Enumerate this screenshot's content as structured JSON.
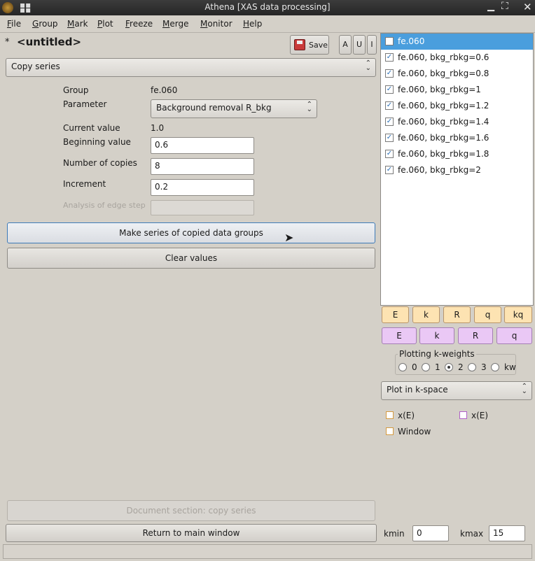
{
  "window": {
    "title": "Athena [XAS data processing]"
  },
  "menu": [
    "File",
    "Group",
    "Mark",
    "Plot",
    "Freeze",
    "Merge",
    "Monitor",
    "Help"
  ],
  "project": {
    "modified_marker": "*",
    "name": "<untitled>"
  },
  "toolbar": {
    "save_label": "Save",
    "a_label": "A",
    "u_label": "U",
    "i_label": "I"
  },
  "panel_select": "Copy series",
  "form": {
    "group_label": "Group",
    "group_value": "fe.060",
    "parameter_label": "Parameter",
    "parameter_value": "Background removal R_bkg",
    "current_label": "Current value",
    "current_value": "1.0",
    "beginning_label": "Beginning value",
    "beginning_value": "0.6",
    "copies_label": "Number of copies",
    "copies_value": "8",
    "increment_label": "Increment",
    "increment_value": "0.2",
    "edge_label": "Analysis of edge step",
    "edge_value": ""
  },
  "buttons": {
    "make_series": "Make series of copied data groups",
    "clear": "Clear values",
    "document": "Document section: copy series",
    "return": "Return to main window"
  },
  "groups": [
    {
      "label": "fe.060",
      "checked": false,
      "selected": true
    },
    {
      "label": "fe.060, bkg_rbkg=0.6",
      "checked": true
    },
    {
      "label": "fe.060, bkg_rbkg=0.8",
      "checked": true
    },
    {
      "label": "fe.060, bkg_rbkg=1",
      "checked": true
    },
    {
      "label": "fe.060, bkg_rbkg=1.2",
      "checked": true
    },
    {
      "label": "fe.060, bkg_rbkg=1.4",
      "checked": true
    },
    {
      "label": "fe.060, bkg_rbkg=1.6",
      "checked": true
    },
    {
      "label": "fe.060, bkg_rbkg=1.8",
      "checked": true
    },
    {
      "label": "fe.060, bkg_rbkg=2",
      "checked": true
    }
  ],
  "plot_single": [
    "E",
    "k",
    "R",
    "q",
    "kq"
  ],
  "plot_marked": [
    "E",
    "k",
    "R",
    "q"
  ],
  "kweights": {
    "title": "Plotting k-weights",
    "options": [
      "0",
      "1",
      "2",
      "3",
      "kw"
    ],
    "selected": "2"
  },
  "plot_space": "Plot in k-space",
  "plot_options": {
    "xe1": "x(E)",
    "xe2": "x(E)",
    "window": "Window"
  },
  "krange": {
    "kmin_label": "kmin",
    "kmin_value": "0",
    "kmax_label": "kmax",
    "kmax_value": "15"
  },
  "colors": {
    "accent": "#4a9edd",
    "orange": "#fde3b2",
    "purple": "#eac8f5"
  }
}
